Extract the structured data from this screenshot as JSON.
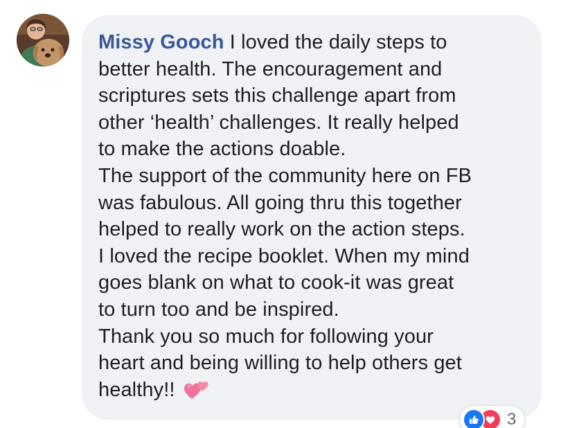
{
  "comment": {
    "author_name": "Missy Gooch",
    "lines": [
      " I loved the daily steps to",
      "better health. The encouragement and",
      "scriptures sets this challenge apart from",
      "other ‘health’ challenges. It really helped",
      "to make the actions doable.",
      "The support of the community here on FB",
      "was fabulous. All going thru this together",
      "helped to really work on the action steps.",
      "I loved the recipe booklet. When my mind",
      "goes blank on what to cook-it was great",
      "to turn too and be inspired.",
      "Thank you so much for following your",
      "heart and being willing to help others get",
      "healthy!!"
    ],
    "emoji": "two-hearts-emoji"
  },
  "reactions": {
    "count": "3",
    "types": [
      "like-icon",
      "love-icon"
    ]
  },
  "colors": {
    "bubble_bg": "#f0f2f5",
    "author": "#385898",
    "text": "#1c1e21",
    "like": "#1877f2",
    "love": "#f33e58"
  }
}
